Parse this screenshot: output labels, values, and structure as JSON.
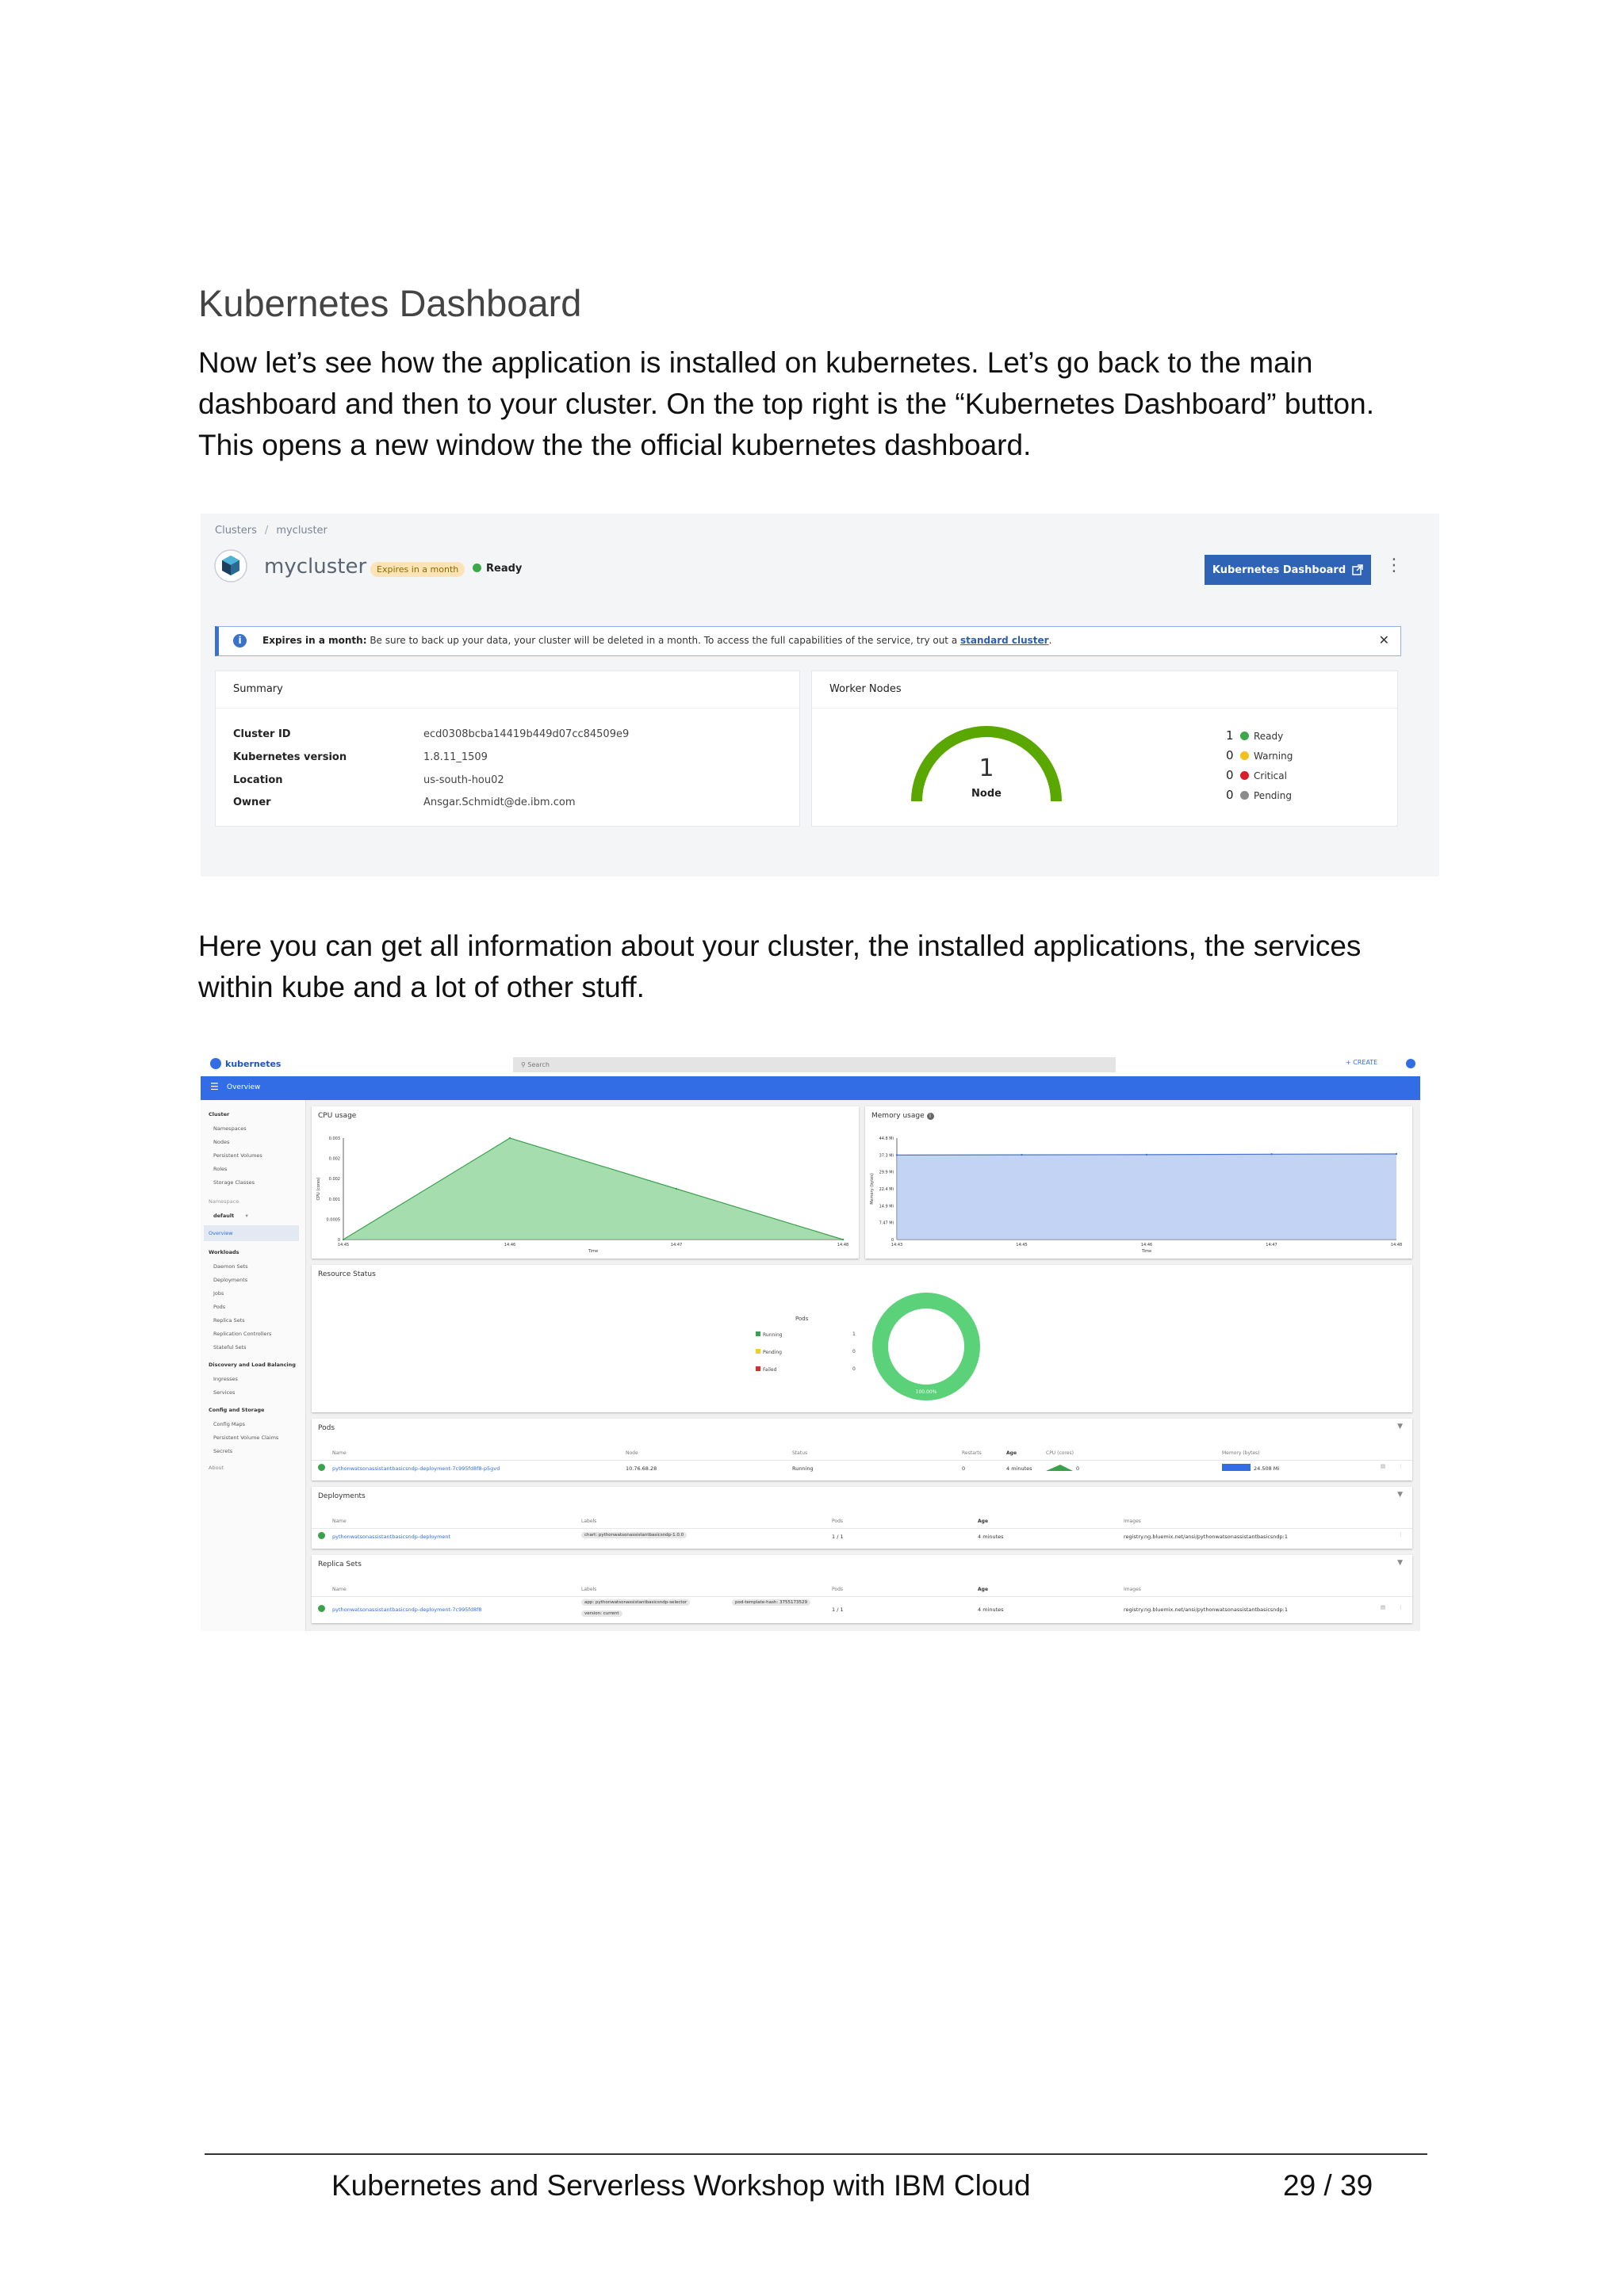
{
  "document": {
    "heading": "Kubernetes Dashboard",
    "paragraph1": "Now let’s see how the application is installed on kubernetes. Let’s go back to the main dashboard and then to your cluster. On the top right is the “Kubernetes Dashboard” button. This opens a new window the the official kubernetes dashboard.",
    "paragraph2": "Here you can get all information about your cluster, the installed applications, the services within kube and a lot of other stuff."
  },
  "footer": {
    "title": "Kubernetes and Serverless Workshop with IBM Cloud",
    "page": "29 / 39"
  },
  "cluster_view": {
    "breadcrumb": {
      "root": "Clusters",
      "separator": "/",
      "current": "mycluster"
    },
    "cluster_name": "mycluster",
    "expires_badge": "Expires in a month",
    "status": "Ready",
    "dashboard_button": "Kubernetes Dashboard",
    "banner": {
      "bold_prefix": "Expires in a month:",
      "text": " Be sure to back up your data, your cluster will be deleted in a month. To access the full capabilities of the service, try out a ",
      "link": "standard cluster",
      "suffix": "."
    },
    "summary": {
      "title": "Summary",
      "rows": [
        {
          "label": "Cluster ID",
          "value": "ecd0308bcba14419b449d07cc84509e9"
        },
        {
          "label": "Kubernetes version",
          "value": "1.8.11_1509"
        },
        {
          "label": "Location",
          "value": "us-south-hou02"
        },
        {
          "label": "Owner",
          "value": "Ansgar.Schmidt@de.ibm.com"
        }
      ]
    },
    "worker_nodes": {
      "title": "Worker Nodes",
      "count": "1",
      "count_label": "Node",
      "gauge_fraction": 1,
      "legend": [
        {
          "count": "1",
          "label": "Ready",
          "color": "#3da84a"
        },
        {
          "count": "0",
          "label": "Warning",
          "color": "#f1c21b"
        },
        {
          "count": "0",
          "label": "Critical",
          "color": "#da1e28"
        },
        {
          "count": "0",
          "label": "Pending",
          "color": "#8c8c8c"
        }
      ]
    }
  },
  "k8s_dashboard": {
    "logo": "kubernetes",
    "search_placeholder": "Search",
    "create_label": "+ CREATE",
    "bar_title": "Overview",
    "sidebar": {
      "cluster_head": "Cluster",
      "cluster_items": [
        "Namespaces",
        "Nodes",
        "Persistent Volumes",
        "Roles",
        "Storage Classes"
      ],
      "namespace_head": "Namespace",
      "namespace_value": "default",
      "overview": "Overview",
      "workloads_head": "Workloads",
      "workload_items": [
        "Daemon Sets",
        "Deployments",
        "Jobs",
        "Pods",
        "Replica Sets",
        "Replication Controllers",
        "Stateful Sets"
      ],
      "discovery_head": "Discovery and Load Balancing",
      "discovery_items": [
        "Ingresses",
        "Services"
      ],
      "config_head": "Config and Storage",
      "config_items": [
        "Config Maps",
        "Persistent Volume Claims",
        "Secrets"
      ],
      "about": "About"
    },
    "cpu_panel": {
      "title": "CPU usage",
      "ylabel": "CPU (cores)",
      "xlabel": "Time",
      "yticks": [
        "0.003",
        "0.002",
        "0.002",
        "0.001",
        "0.0005",
        "0"
      ],
      "xticks": [
        "14:45",
        "14:46",
        "14:47",
        "14:48"
      ]
    },
    "memory_panel": {
      "title": "Memory usage",
      "ylabel": "Memory (bytes)",
      "xlabel": "Time",
      "yticks": [
        "44.8 Mi",
        "37.3 Mi",
        "29.9 Mi",
        "22.4 Mi",
        "14.9 Mi",
        "7.47 Mi",
        "0"
      ],
      "xticks": [
        "14:43",
        "14:45",
        "14:46",
        "14:47",
        "14:48"
      ]
    },
    "chart_data": [
      {
        "type": "area",
        "title": "CPU usage",
        "xlabel": "Time",
        "ylabel": "CPU (cores)",
        "x": [
          "14:45",
          "14:46",
          "14:47",
          "14:48"
        ],
        "series": [
          {
            "values": [
              0,
              0.003,
              0.0015,
              0
            ]
          }
        ],
        "ylim": [
          0,
          0.003
        ],
        "color": "#7fcf8d"
      },
      {
        "type": "area",
        "title": "Memory usage",
        "xlabel": "Time",
        "ylabel": "Memory (bytes)",
        "x": [
          "14:43",
          "14:45",
          "14:46",
          "14:47",
          "14:48"
        ],
        "series": [
          {
            "values": [
              37.3,
              37.4,
              37.5,
              37.7,
              37.8
            ]
          }
        ],
        "ylim": [
          0,
          44.8
        ],
        "color": "#a8c0f0"
      },
      {
        "type": "pie",
        "title": "Pods",
        "categories": [
          "Running",
          "Pending",
          "Failed"
        ],
        "values": [
          1,
          0,
          0
        ],
        "center_label": "100.00%"
      }
    ],
    "resource_status": {
      "title": "Resource Status",
      "pods_label": "Pods",
      "legend": [
        {
          "label": "Running",
          "count": "1",
          "color": "#3ba14c"
        },
        {
          "label": "Pending",
          "count": "0",
          "color": "#f2d01f"
        },
        {
          "label": "Failed",
          "count": "0",
          "color": "#d32f2f"
        }
      ],
      "donut_label": "100.00%",
      "donut_color": "#5bd17a"
    },
    "pods": {
      "title": "Pods",
      "headers": [
        "Name",
        "Node",
        "Status",
        "Restarts",
        "Age",
        "CPU (cores)",
        "Memory (bytes)"
      ],
      "row": {
        "name": "pythonwatsonassistantbasicsndp-deployment-7c995fd8f8-p5gvd",
        "node": "10.76.68.28",
        "status": "Running",
        "restarts": "0",
        "age": "4 minutes",
        "cpu": "0",
        "memory": "24.508 Mi"
      }
    },
    "deployments": {
      "title": "Deployments",
      "headers": [
        "Name",
        "Labels",
        "Pods",
        "Age",
        "Images"
      ],
      "row": {
        "name": "pythonwatsonassistantbasicsndp-deployment",
        "label": "chart: pythonwatsonassistantbasicsndp-1.0.0",
        "pods": "1 / 1",
        "age": "4 minutes",
        "image": "registry.ng.bluemix.net/ansi/pythonwatsonassistantbasicsndp:1"
      }
    },
    "replica_sets": {
      "title": "Replica Sets",
      "headers": [
        "Name",
        "Labels",
        "Pods",
        "Age",
        "Images"
      ],
      "row": {
        "name": "pythonwatsonassistantbasicsndp-deployment-7c995fd8f8",
        "label1": "app: pythonwatsonassistantbasicsndp-selector",
        "label2": "pod-template-hash: 3755173529",
        "label3": "version: current",
        "pods": "1 / 1",
        "age": "4 minutes",
        "image": "registry.ng.bluemix.net/ansi/pythonwatsonassistantbasicsndp:1"
      }
    }
  }
}
